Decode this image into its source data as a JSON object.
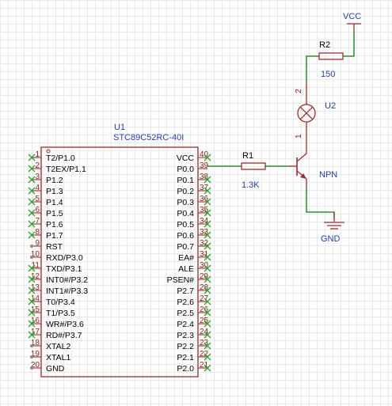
{
  "colors": {
    "body": "#a52a2a",
    "wire": "#008000",
    "pin_number": "#8b1a1a",
    "label_blue": "#1f3fbf",
    "noconnect": "#22aa22",
    "text": "#000000"
  },
  "mcu": {
    "refdes": "U1",
    "part": "STC89C52RC-40I",
    "left_pins": [
      {
        "num": "1",
        "name": "T2/P1.0"
      },
      {
        "num": "2",
        "name": "T2EX/P1.1"
      },
      {
        "num": "3",
        "name": "P1.2"
      },
      {
        "num": "4",
        "name": "P1.3"
      },
      {
        "num": "5",
        "name": "P1.4"
      },
      {
        "num": "6",
        "name": "P1.5"
      },
      {
        "num": "7",
        "name": "P1.6"
      },
      {
        "num": "8",
        "name": "P1.7"
      },
      {
        "num": "9",
        "name": "RST"
      },
      {
        "num": "10",
        "name": "RXD/P3.0"
      },
      {
        "num": "11",
        "name": "TXD/P3.1"
      },
      {
        "num": "12",
        "name": "INT0#/P3.2"
      },
      {
        "num": "13",
        "name": "INT1#/P3.3"
      },
      {
        "num": "14",
        "name": "T0/P3.4"
      },
      {
        "num": "15",
        "name": "T1/P3.5"
      },
      {
        "num": "16",
        "name": "WR#/P3.6"
      },
      {
        "num": "17",
        "name": "RD#/P3.7"
      },
      {
        "num": "18",
        "name": "XTAL2"
      },
      {
        "num": "19",
        "name": "XTAL1"
      },
      {
        "num": "20",
        "name": "GND"
      }
    ],
    "right_pins": [
      {
        "num": "40",
        "name": "VCC"
      },
      {
        "num": "39",
        "name": "P0.0"
      },
      {
        "num": "38",
        "name": "P0.1"
      },
      {
        "num": "37",
        "name": "P0.2"
      },
      {
        "num": "36",
        "name": "P0.3"
      },
      {
        "num": "35",
        "name": "P0.4"
      },
      {
        "num": "34",
        "name": "P0.5"
      },
      {
        "num": "33",
        "name": "P0.6"
      },
      {
        "num": "32",
        "name": "P0.7"
      },
      {
        "num": "31",
        "name": "EA#"
      },
      {
        "num": "30",
        "name": "ALE"
      },
      {
        "num": "29",
        "name": "PSEN#"
      },
      {
        "num": "28",
        "name": "P2.7"
      },
      {
        "num": "27",
        "name": "P2.6"
      },
      {
        "num": "26",
        "name": "P2.5"
      },
      {
        "num": "25",
        "name": "P2.4"
      },
      {
        "num": "24",
        "name": "P2.3"
      },
      {
        "num": "23",
        "name": "P2.2"
      },
      {
        "num": "22",
        "name": "P2.1"
      },
      {
        "num": "21",
        "name": "P2.0"
      }
    ],
    "left_noconnect": [
      "1",
      "2",
      "3",
      "4",
      "5",
      "6",
      "7",
      "8",
      "11",
      "12",
      "13",
      "14",
      "15",
      "16",
      "17"
    ],
    "left_dot": [
      "9",
      "10",
      "18",
      "19",
      "20"
    ],
    "right_noconnect": [
      "40",
      "38",
      "37",
      "36",
      "35",
      "34",
      "33",
      "32",
      "31",
      "30",
      "29",
      "28",
      "27",
      "26",
      "25",
      "24",
      "23",
      "22",
      "21"
    ]
  },
  "r1": {
    "refdes": "R1",
    "value": "1.3K"
  },
  "r2": {
    "refdes": "R2",
    "value": "150"
  },
  "u2": {
    "refdes": "U2",
    "pin_top": "2",
    "pin_bottom": "1"
  },
  "q1": {
    "type": "NPN"
  },
  "power": {
    "vcc": "VCC",
    "gnd": "GND"
  }
}
